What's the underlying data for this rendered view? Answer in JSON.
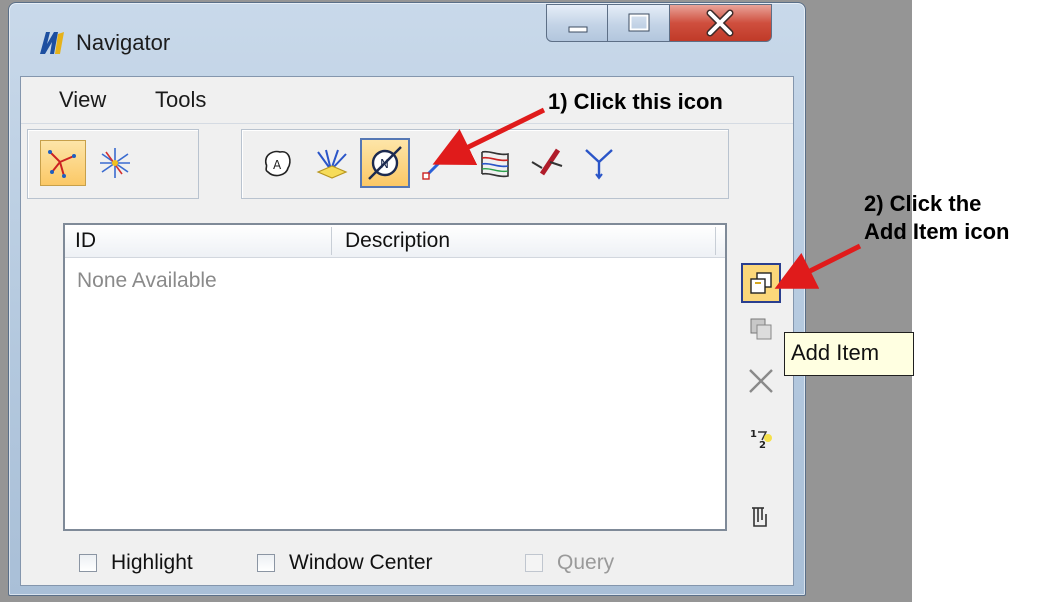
{
  "window": {
    "title": "Navigator"
  },
  "menu": {
    "view": "View",
    "tools": "Tools"
  },
  "list": {
    "columns": [
      "ID",
      "Description"
    ],
    "empty_text": "None Available"
  },
  "tooltip": {
    "text": "Add Item"
  },
  "options": {
    "highlight": "Highlight",
    "window_center": "Window Center",
    "query": "Query"
  },
  "annotations": {
    "step1": "1) Click this icon",
    "step2_line1": "2) Click the",
    "step2_line2": "Add Item icon"
  },
  "colors": {
    "arrow": "#e01b1b",
    "active_tool": "#fbc866"
  }
}
